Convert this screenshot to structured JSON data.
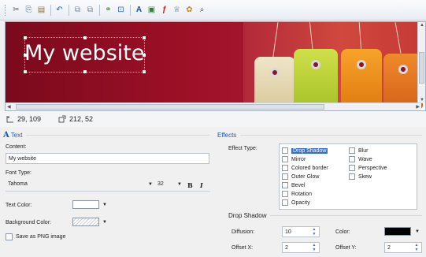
{
  "toolbar": {
    "buttons": [
      {
        "icon": "cut-icon",
        "glyph": "✂"
      },
      {
        "icon": "copy-icon",
        "glyph": "⎘"
      },
      {
        "icon": "paste-icon",
        "glyph": "📋"
      },
      {
        "icon": "undo-icon",
        "glyph": "↶"
      },
      {
        "icon": "bring-forward-icon",
        "glyph": "⧉"
      },
      {
        "icon": "send-backward-icon",
        "glyph": "⧉"
      },
      {
        "icon": "group-icon",
        "glyph": "⚭"
      },
      {
        "icon": "resize-icon",
        "glyph": "⊡"
      },
      {
        "icon": "text-icon",
        "glyph": "A"
      },
      {
        "icon": "image-icon",
        "glyph": "▣"
      },
      {
        "icon": "flash-icon",
        "glyph": "ƒ"
      },
      {
        "icon": "shape-icon",
        "glyph": "♕"
      },
      {
        "icon": "clipart-icon",
        "glyph": "✿"
      },
      {
        "icon": "find-icon",
        "glyph": "⌕"
      }
    ]
  },
  "banner": {
    "title": "My website",
    "colors": {
      "background": "#9e1027",
      "title": "#ffffff"
    }
  },
  "status": {
    "position": "29, 109",
    "size": "212, 52"
  },
  "text_panel": {
    "header": "Text",
    "content_label": "Content:",
    "content_value": "My website",
    "font_label": "Font Type:",
    "font_value": "Tahoma",
    "font_size": "32",
    "bold_label": "B",
    "italic_label": "I",
    "text_color_label": "Text Color:",
    "text_color": "#ffffff",
    "bg_color_label": "Background Color:",
    "save_png_label": "Save as PNG image"
  },
  "effects_panel": {
    "header": "Effects",
    "type_label": "Effect Type:",
    "effects_col1": [
      "Drop Shadow",
      "Mirror",
      "Colored border",
      "Outer Glow",
      "Bevel",
      "Rotation",
      "Opacity"
    ],
    "effects_col2": [
      "Blur",
      "Wave",
      "Perspective",
      "Skew"
    ],
    "selected_effect": "Drop Shadow",
    "shadow_header": "Drop Shadow",
    "diffusion_label": "Diffusion:",
    "diffusion_value": "10",
    "color_label": "Color:",
    "shadow_color": "#000000",
    "offset_x_label": "Offset X:",
    "offset_x_value": "2",
    "offset_y_label": "Offset Y:",
    "offset_y_value": "2"
  }
}
